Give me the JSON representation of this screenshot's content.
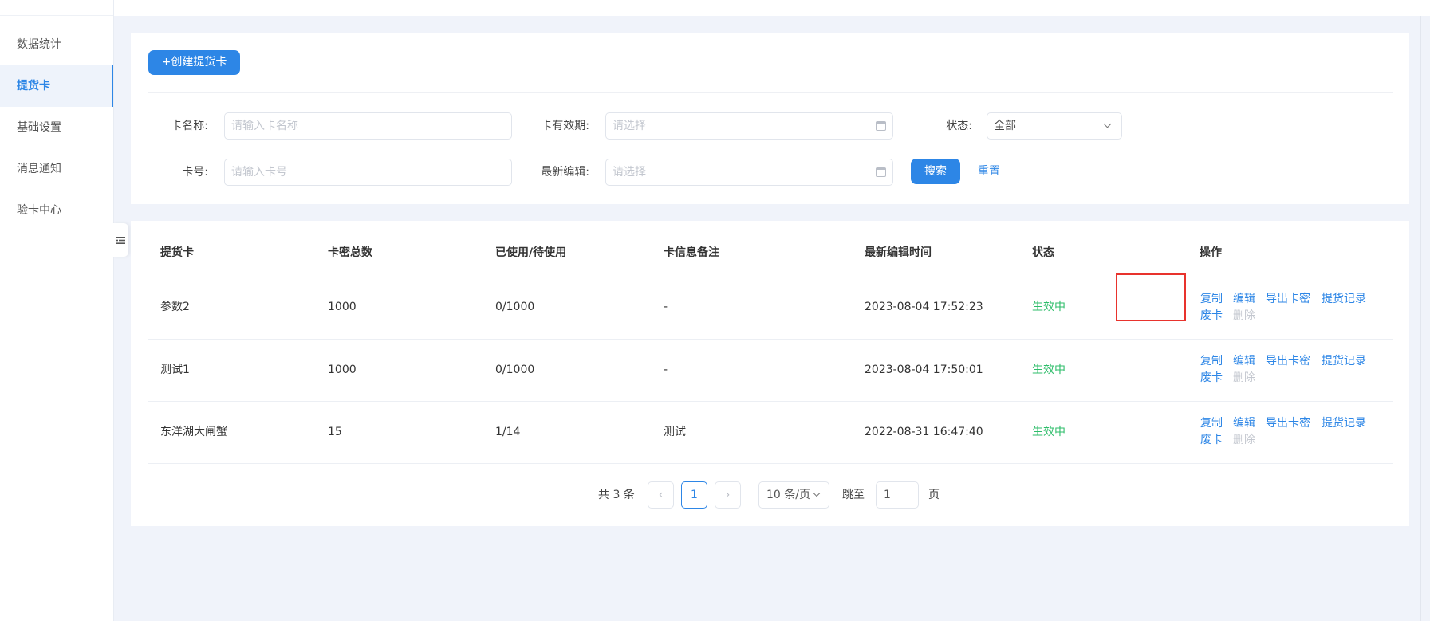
{
  "sidebar": {
    "items": [
      {
        "label": "数据统计",
        "active": false
      },
      {
        "label": "提货卡",
        "active": true
      },
      {
        "label": "基础设置",
        "active": false
      },
      {
        "label": "消息通知",
        "active": false
      },
      {
        "label": "验卡中心",
        "active": false
      }
    ],
    "collapse_icon": "menu-fold-icon"
  },
  "toolbar": {
    "create_label": "+创建提货卡"
  },
  "filters": {
    "card_name": {
      "label": "卡名称:",
      "placeholder": "请输入卡名称"
    },
    "validity": {
      "label": "卡有效期:",
      "placeholder": "请选择"
    },
    "status": {
      "label": "状态:",
      "value": "全部"
    },
    "card_no": {
      "label": "卡号:",
      "placeholder": "请输入卡号"
    },
    "last_edit": {
      "label": "最新编辑:",
      "placeholder": "请选择"
    },
    "search_label": "搜索",
    "reset_label": "重置"
  },
  "table": {
    "headers": [
      "提货卡",
      "卡密总数",
      "已使用/待使用",
      "卡信息备注",
      "最新编辑时间",
      "状态",
      "操作"
    ],
    "rows": [
      {
        "name": "参数2",
        "total": "1000",
        "usage": "0/1000",
        "note": "-",
        "time": "2023-08-04 17:52:23",
        "status": "生效中"
      },
      {
        "name": "测试1",
        "total": "1000",
        "usage": "0/1000",
        "note": "-",
        "time": "2023-08-04 17:50:01",
        "status": "生效中"
      },
      {
        "name": "东洋湖大闸蟹",
        "total": "15",
        "usage": "1/14",
        "note": "测试",
        "time": "2022-08-31 16:47:40",
        "status": "生效中"
      }
    ],
    "actions": {
      "copy": "复制",
      "edit": "编辑",
      "export": "导出卡密",
      "records": "提货记录",
      "void": "废卡",
      "delete": "删除"
    }
  },
  "pagination": {
    "total": "共 3 条",
    "current": "1",
    "page_size": "10 条/页",
    "goto_label": "跳至",
    "goto_value": "1",
    "unit": "页"
  },
  "colors": {
    "accent": "#2d86e6",
    "status_active": "#2ebd6a",
    "highlight": "#e8332d",
    "disabled": "#c3c7cf"
  }
}
